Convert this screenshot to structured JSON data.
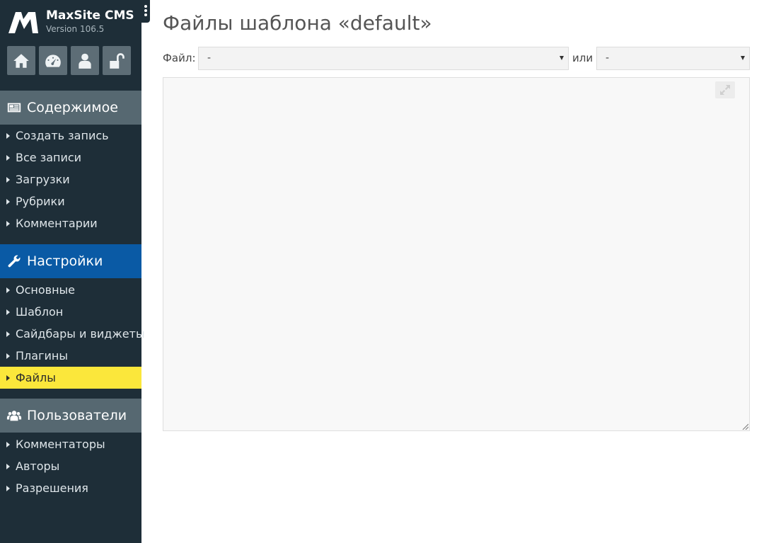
{
  "brand": {
    "name": "MaxSite CMS",
    "version": "Version 106.5"
  },
  "quick_buttons": [
    {
      "icon": "home-icon"
    },
    {
      "icon": "dashboard-icon"
    },
    {
      "icon": "user-icon"
    },
    {
      "icon": "unlock-icon"
    }
  ],
  "sidebar": {
    "content": {
      "title": "Содержимое",
      "items": [
        "Создать запись",
        "Все записи",
        "Загрузки",
        "Рубрики",
        "Комментарии"
      ]
    },
    "settings": {
      "title": "Настройки",
      "items": [
        "Основные",
        "Шаблон",
        "Сайдбары и виджеты",
        "Плагины",
        "Файлы"
      ],
      "active": "Файлы"
    },
    "users": {
      "title": "Пользователи",
      "items": [
        "Комментаторы",
        "Авторы",
        "Разрешения"
      ]
    }
  },
  "main": {
    "title": "Файлы шаблона «default»",
    "file_label": "Файл:",
    "file_select_value": "-",
    "or_label": "или",
    "second_select_value": "-"
  },
  "colors": {
    "sidebar_bg": "#1e2e38",
    "section_bg": "#566871",
    "active_section_bg": "#0a5aa5",
    "active_item_bg": "#fbe73b"
  }
}
